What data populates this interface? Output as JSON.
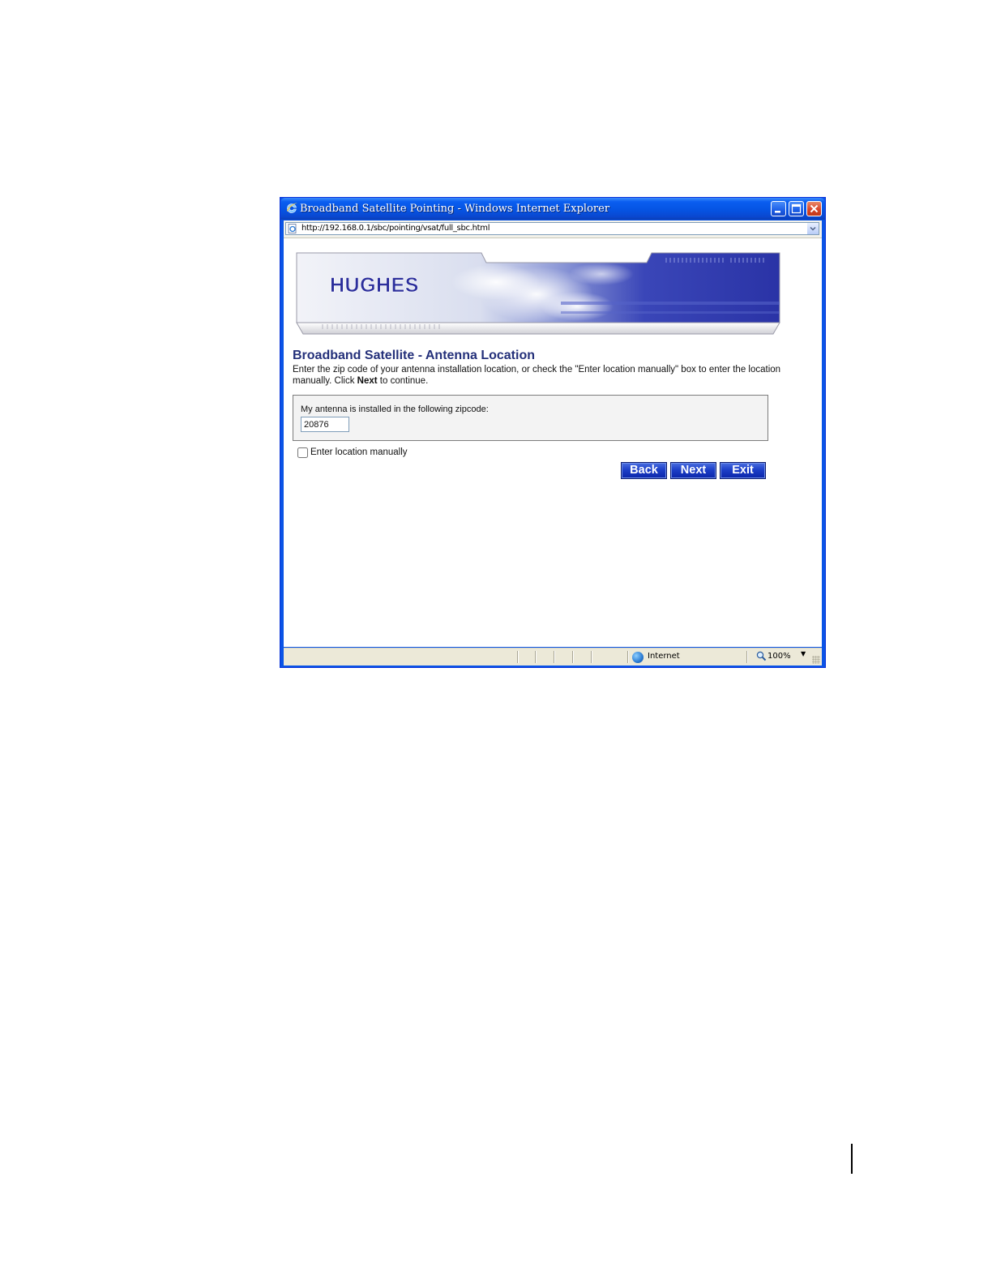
{
  "window": {
    "title": "Broadband Satellite Pointing - Windows Internet Explorer",
    "address_url": "http://192.168.0.1/sbc/pointing/vsat/full_sbc.html"
  },
  "banner": {
    "logo_text": "HUGHES",
    "brand_color": "#2c2f9c"
  },
  "page": {
    "heading": "Broadband Satellite - Antenna Location",
    "instructions_part1": "Enter the zip code of your antenna installation location, or check the \"Enter location manually\" box to enter the location manually. Click ",
    "instructions_bold": "Next",
    "instructions_part2": " to continue.",
    "zip_label": "My antenna is installed in the following zipcode:",
    "zip_value": "20876",
    "manual_checkbox_label": "Enter location manually",
    "manual_checkbox_checked": false
  },
  "buttons": {
    "back": "Back",
    "next": "Next",
    "exit": "Exit"
  },
  "statusbar": {
    "zone": "Internet",
    "zoom": "100%"
  },
  "colors": {
    "heading": "#24307a",
    "button_blue": "#1d3fc8",
    "xp_title_blue": "#0554e3"
  }
}
